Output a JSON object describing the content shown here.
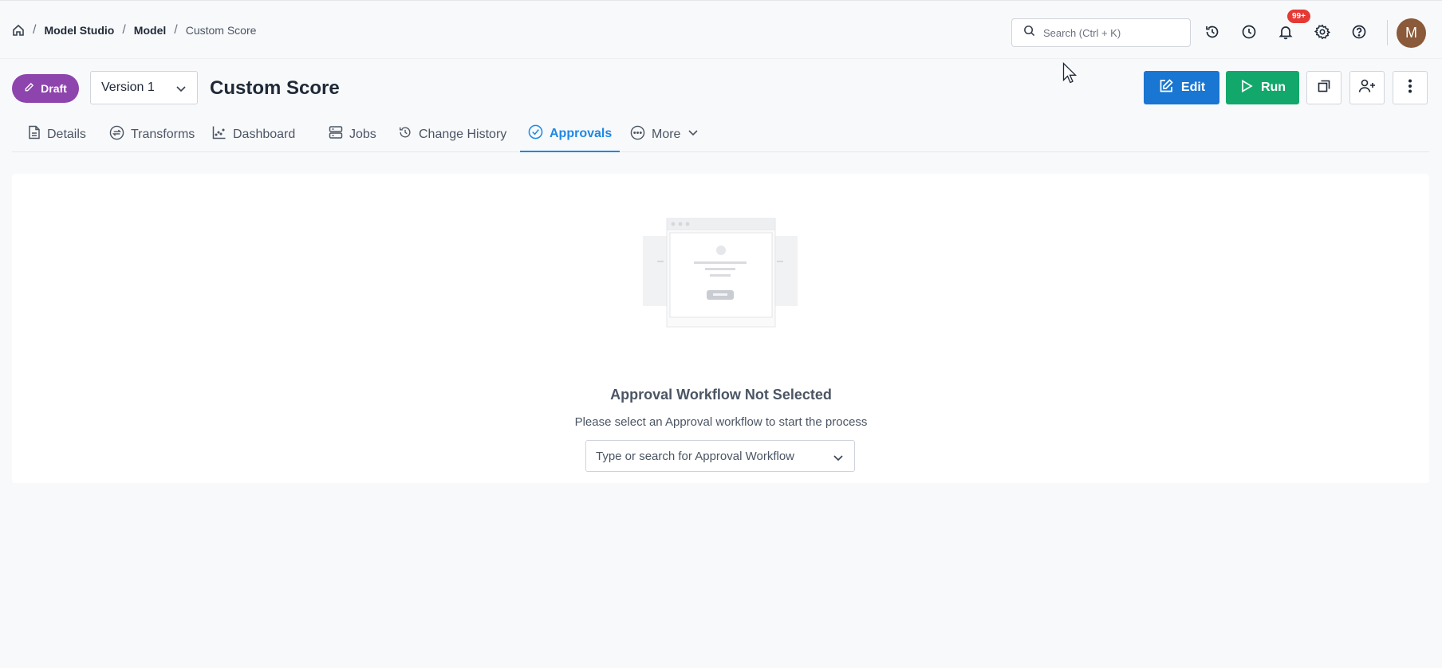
{
  "breadcrumb": {
    "items": [
      "Model Studio",
      "Model"
    ],
    "current": "Custom Score"
  },
  "search": {
    "placeholder": "Search (Ctrl + K)"
  },
  "notifications": {
    "badge": "99+"
  },
  "user": {
    "avatar_initial": "M"
  },
  "header": {
    "status_badge": "Draft",
    "version_selected": "Version 1",
    "title": "Custom Score",
    "edit_label": "Edit",
    "run_label": "Run"
  },
  "tabs": [
    {
      "label": "Details",
      "icon": "document-icon"
    },
    {
      "label": "Transforms",
      "icon": "sync-icon"
    },
    {
      "label": "Dashboard",
      "icon": "chart-icon"
    },
    {
      "label": "Jobs",
      "icon": "server-icon"
    },
    {
      "label": "Change History",
      "icon": "history-icon"
    },
    {
      "label": "Approvals",
      "icon": "check-circle-icon",
      "active": true
    },
    {
      "label": "More",
      "icon": "ellipsis-circle-icon"
    }
  ],
  "empty_state": {
    "title": "Approval Workflow Not Selected",
    "subtitle": "Please select an Approval workflow to start the process",
    "select_placeholder": "Type or search for Approval Workflow"
  },
  "colors": {
    "primary": "#1976d2",
    "success": "#13a86b",
    "draft": "#8e44ad",
    "badge": "#e53935",
    "active_tab": "#1e88e5"
  }
}
